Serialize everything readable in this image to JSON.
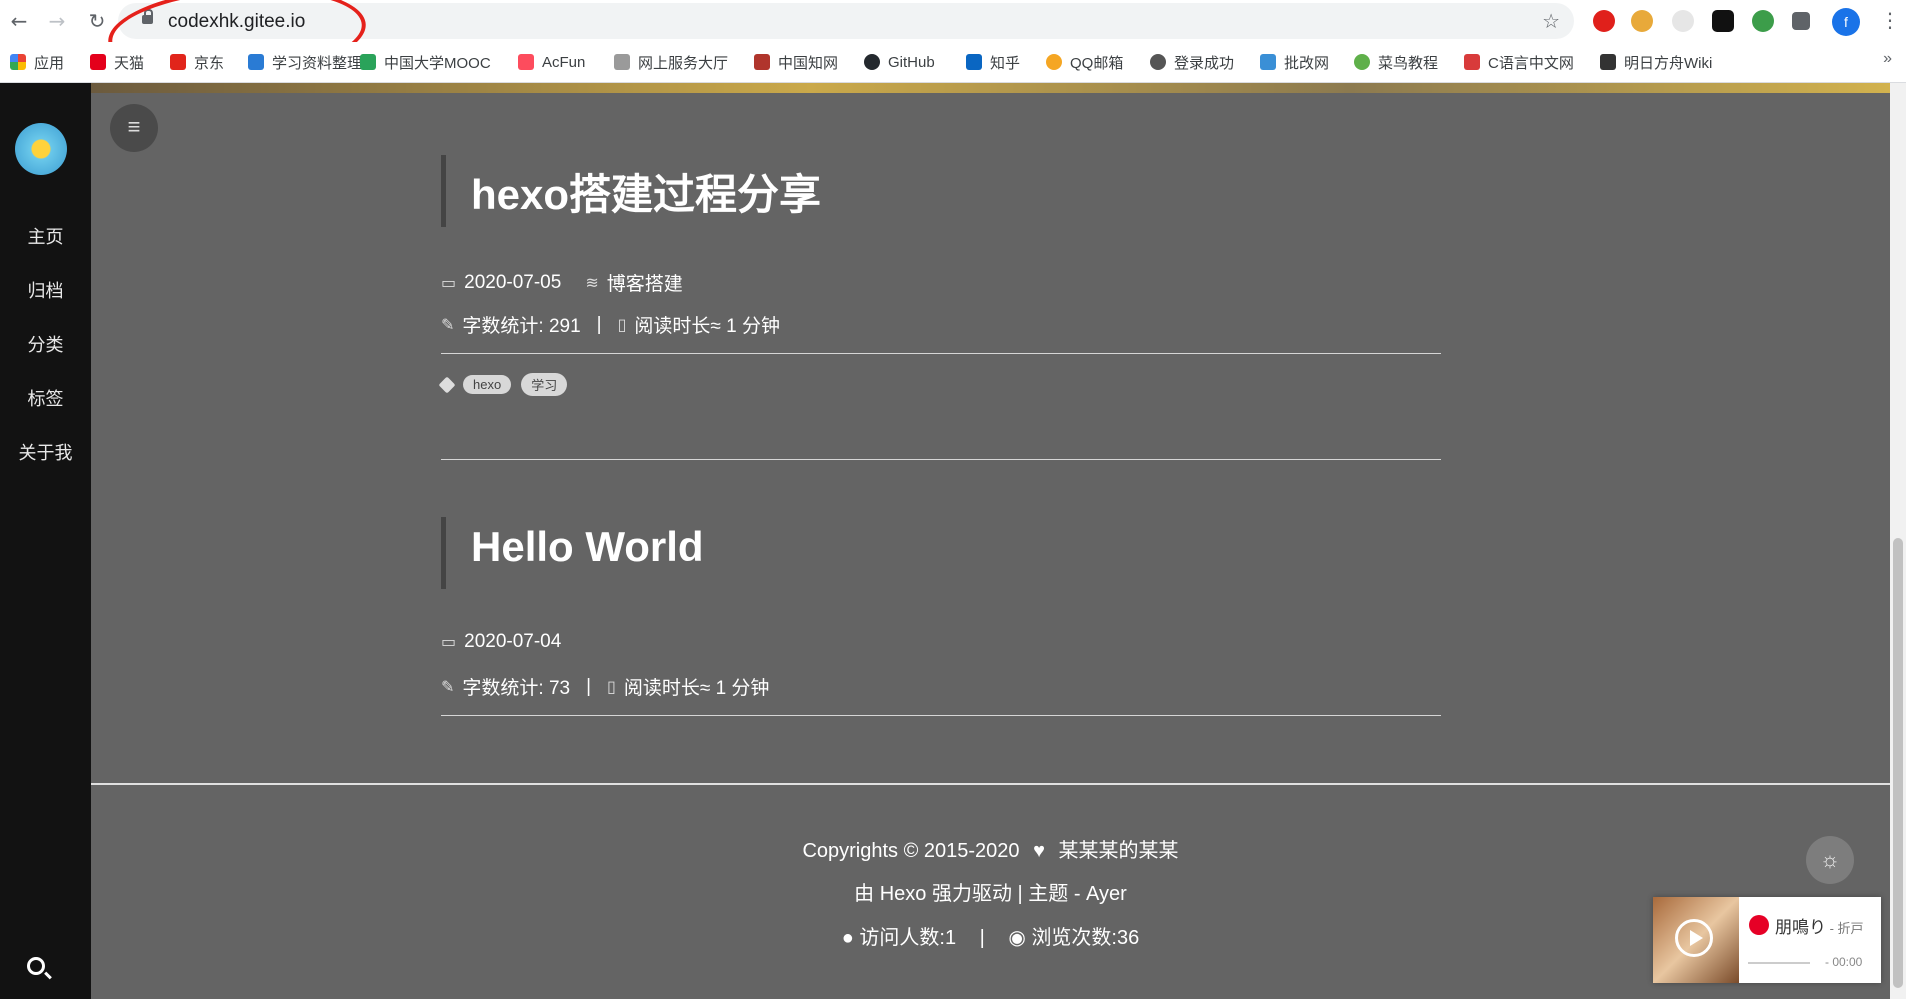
{
  "browser": {
    "url": "codexhk.gitee.io",
    "profile_initial": "f",
    "bookmarks_more": "»"
  },
  "bookmarks": [
    {
      "label": "应用",
      "color": "#ea4335"
    },
    {
      "label": "天猫",
      "color": "#e4001b"
    },
    {
      "label": "京东",
      "color": "#e1251b"
    },
    {
      "label": "学习资料整理",
      "color": "#2a7bd4"
    },
    {
      "label": "中国大学MOOC",
      "color": "#2aa35a"
    },
    {
      "label": "AcFun",
      "color": "#fd4c5d"
    },
    {
      "label": "网上服务大厅",
      "color": "#9a9a9a"
    },
    {
      "label": "中国知网",
      "color": "#b0352c"
    },
    {
      "label": "GitHub",
      "color": "#24292e"
    },
    {
      "label": "知乎",
      "color": "#0a66c2"
    },
    {
      "label": "QQ邮箱",
      "color": "#f5a623"
    },
    {
      "label": "登录成功",
      "color": "#555555"
    },
    {
      "label": "批改网",
      "color": "#3a8fd6"
    },
    {
      "label": "菜鸟教程",
      "color": "#5fb04a"
    },
    {
      "label": "C语言中文网",
      "color": "#d83b3b"
    },
    {
      "label": "明日方舟Wiki",
      "color": "#333333"
    }
  ],
  "sidebar": {
    "items": [
      {
        "label": "主页"
      },
      {
        "label": "归档"
      },
      {
        "label": "分类"
      },
      {
        "label": "标签"
      },
      {
        "label": "关于我"
      }
    ]
  },
  "posts": [
    {
      "title": "hexo搭建过程分享",
      "date": "2020-07-05",
      "category": "博客搭建",
      "word_count": "字数统计: 291",
      "read_time": "阅读时长≈ 1 分钟",
      "separator": "|",
      "tags": [
        "hexo",
        "学习"
      ]
    },
    {
      "title": "Hello World",
      "date": "2020-07-04",
      "word_count": "字数统计: 73",
      "read_time": "阅读时长≈ 1 分钟",
      "separator": "|"
    }
  ],
  "footer": {
    "copyright": "Copyrights © 2015-2020",
    "author": "某某某的某某",
    "powered": "由 Hexo 强力驱动  |  主题 - Ayer",
    "visitors": "访问人数:1",
    "views": "浏览次数:36",
    "separator": "|"
  },
  "player": {
    "song": "朋鳴り",
    "artist": " - 折戸",
    "time": "- 00:00"
  }
}
